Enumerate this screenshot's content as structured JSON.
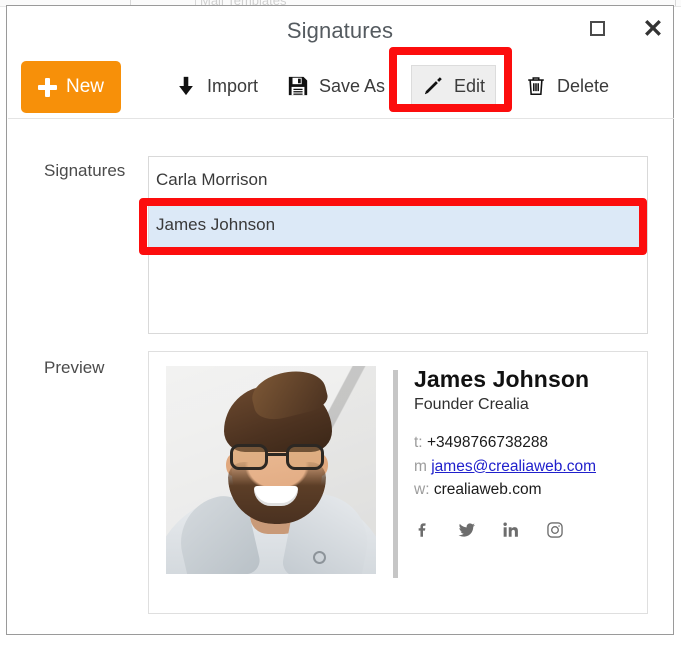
{
  "background": {
    "ghost_text": "Mail Templates"
  },
  "window": {
    "title": "Signatures",
    "maximize_label": "Maximize",
    "close_label": "Close"
  },
  "toolbar": {
    "new_label": "New",
    "import_label": "Import",
    "save_as_label": "Save As",
    "edit_label": "Edit",
    "delete_label": "Delete",
    "new_button_color": "#f79009",
    "highlight_color": "#fc0d0d",
    "icons": {
      "new": "plus-icon",
      "import": "download-arrow-icon",
      "save_as": "floppy-disk-icon",
      "edit": "pencil-icon",
      "delete": "trash-icon"
    }
  },
  "form": {
    "signatures_label": "Signatures",
    "preview_label": "Preview"
  },
  "signature_list": {
    "items": [
      {
        "name": "Carla Morrison",
        "selected": false
      },
      {
        "name": "James Johnson",
        "selected": true
      }
    ],
    "selected_row_color": "#dce9f7"
  },
  "preview": {
    "photo_alt": "portrait-photo",
    "name": "James Johnson",
    "role": "Founder Crealia",
    "contacts": [
      {
        "key": "t:",
        "value": "+3498766738288",
        "is_link": false
      },
      {
        "key": "m",
        "value": "james@crealiaweb.com",
        "is_link": true
      },
      {
        "key": "w:",
        "value": "crealiaweb.com",
        "is_link": false
      }
    ],
    "link_color": "#2020cc",
    "socials": [
      "facebook-icon",
      "twitter-icon",
      "linkedin-icon",
      "instagram-icon"
    ]
  }
}
